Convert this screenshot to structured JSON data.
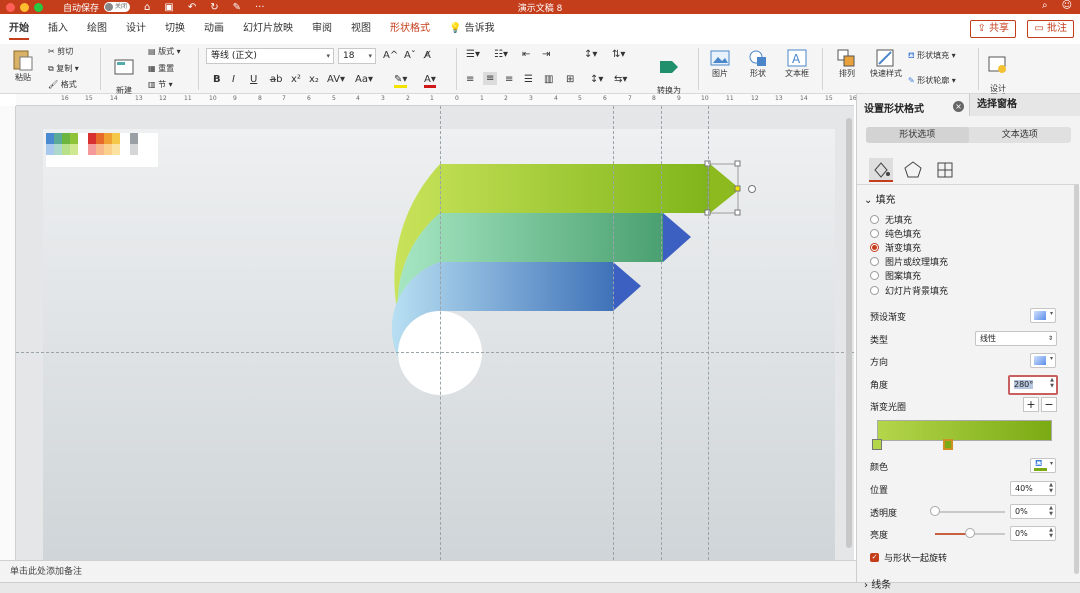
{
  "titlebar": {
    "autosave": "自动保存",
    "autosave_state": "关闭",
    "title": "演示文稿 8"
  },
  "tabs": [
    "开始",
    "插入",
    "绘图",
    "设计",
    "切换",
    "动画",
    "幻灯片放映",
    "审阅",
    "视图",
    "形状格式"
  ],
  "tell_me": "告诉我",
  "share": "共享",
  "comment": "批注",
  "ribbon": {
    "paste": "粘贴",
    "cut": "剪切",
    "copy": "复制",
    "format_painter": "格式",
    "new_slide": "新建\n幻灯片",
    "layout": "版式",
    "reset": "重置",
    "section": "节",
    "font_name": "等线 (正文)",
    "font_size": "18",
    "convert_smartart": "转换为\nSmartArt",
    "picture": "图片",
    "shape": "形状",
    "textbox": "文本框",
    "arrange": "排列",
    "quick_styles": "快速样式",
    "shape_fill": "形状填充",
    "shape_outline": "形状轮廓",
    "design_ideas": "设计\n灵感"
  },
  "ruler_ticks": [
    "16",
    "15",
    "14",
    "13",
    "12",
    "11",
    "10",
    "9",
    "8",
    "7",
    "6",
    "5",
    "4",
    "3",
    "2",
    "1",
    "0",
    "1",
    "2",
    "3",
    "4",
    "5",
    "6",
    "7",
    "8",
    "9",
    "10",
    "11",
    "12",
    "13",
    "14",
    "15",
    "16"
  ],
  "notes_placeholder": "单击此处添加备注",
  "pane": {
    "title": "设置形状格式",
    "other_tab": "选择窗格",
    "seg_shape": "形状选项",
    "seg_text": "文本选项",
    "fill_section": "填充",
    "fill_options": [
      "无填充",
      "纯色填充",
      "渐变填充",
      "图片或纹理填充",
      "图案填充",
      "幻灯片背景填充"
    ],
    "selected_fill": "渐变填充",
    "preset": "预设渐变",
    "type_label": "类型",
    "type_value": "线性",
    "direction": "方向",
    "angle_label": "角度",
    "angle_value": "280°",
    "stops_label": "渐变光圈",
    "color_label": "颜色",
    "position_label": "位置",
    "position_value": "40%",
    "transparency_label": "透明度",
    "transparency_value": "0%",
    "transparency_level": 0,
    "brightness_label": "亮度",
    "brightness_value": "0%",
    "brightness_level": 0.5,
    "rotate_with_shape": "与形状一起旋转",
    "line_section": "线条"
  }
}
